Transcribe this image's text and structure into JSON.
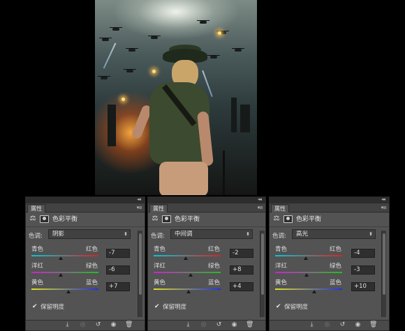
{
  "artwork": {
    "description_icon": "artwork-image"
  },
  "panels": [
    {
      "tab": "属性",
      "title": "色彩平衡",
      "tone_label": "色调:",
      "tone_value": "阴影",
      "sliders": [
        {
          "left": "青色",
          "right": "红色",
          "value": "-7",
          "level": 0.44
        },
        {
          "left": "洋红",
          "right": "绿色",
          "value": "-6",
          "level": 0.44
        },
        {
          "left": "黄色",
          "right": "蓝色",
          "value": "+7",
          "level": 0.55
        }
      ],
      "preserve_label": "保留明度",
      "preserve_checked": true
    },
    {
      "tab": "属性",
      "title": "色彩平衡",
      "tone_label": "色调:",
      "tone_value": "中间调",
      "sliders": [
        {
          "left": "青色",
          "right": "红色",
          "value": "-2",
          "level": 0.48
        },
        {
          "left": "洋红",
          "right": "绿色",
          "value": "+8",
          "level": 0.55
        },
        {
          "left": "黄色",
          "right": "蓝色",
          "value": "+4",
          "level": 0.52
        }
      ],
      "preserve_label": "保留明度",
      "preserve_checked": true
    },
    {
      "tab": "属性",
      "title": "色彩平衡",
      "tone_label": "色调:",
      "tone_value": "高光",
      "sliders": [
        {
          "left": "青色",
          "right": "红色",
          "value": "-4",
          "level": 0.46
        },
        {
          "left": "洋红",
          "right": "绿色",
          "value": "-3",
          "level": 0.47
        },
        {
          "left": "黄色",
          "right": "蓝色",
          "value": "+10",
          "level": 0.58
        }
      ],
      "preserve_label": "保留明度",
      "preserve_checked": true
    }
  ],
  "colors": {
    "panel_bg": "#535353",
    "track_cyan_red": [
      "#00c8d8",
      "#e02020"
    ],
    "track_magenta_green": [
      "#d020d0",
      "#20c020"
    ],
    "track_yellow_blue": [
      "#e0e020",
      "#2030e0"
    ]
  },
  "icons": {
    "balance": "balance-scale-icon",
    "mask": "mask-icon",
    "clip": "clip-to-layer-icon",
    "view_previous": "view-previous-icon",
    "reset": "reset-icon",
    "visibility": "eye-icon",
    "delete": "trash-icon"
  }
}
